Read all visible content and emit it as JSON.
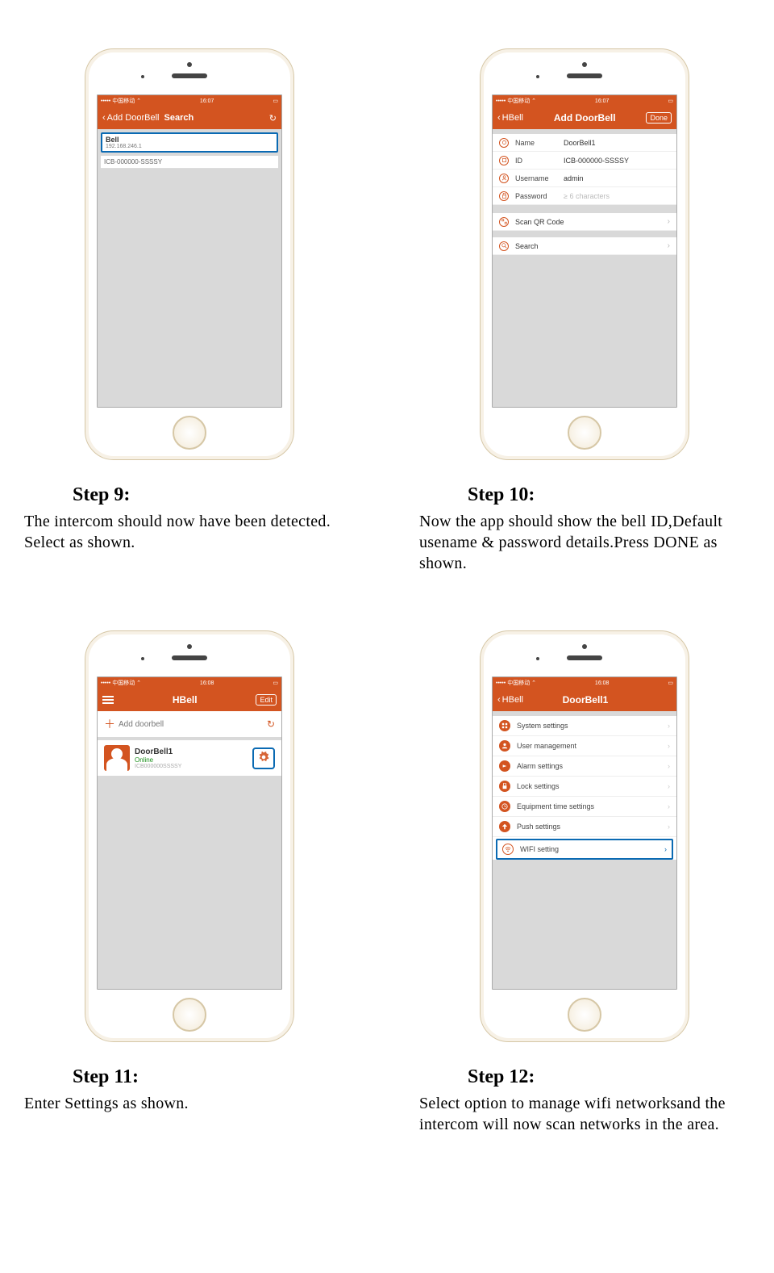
{
  "statusbar": {
    "carrier": "••••• 中国移动 ⌃",
    "time9": "16:07",
    "time10": "16:07",
    "time11": "16:08",
    "time12": "16:08"
  },
  "step9": {
    "title": "Step 9",
    "desc": "The intercom should now have been  detected. Select as shown.",
    "nav_back": "Add DoorBell",
    "nav_title": "Search",
    "bell_name": "Bell",
    "bell_ip": "192.168.246.1",
    "bell_id": "ICB-000000-SSSSY"
  },
  "step10": {
    "title": "Step 10",
    "desc": "Now the app should show the bell  ID,Default usename & password details.Press DONE as shown.",
    "nav_back": "HBell",
    "nav_title": "Add DoorBell",
    "nav_done": "Done",
    "fields": {
      "name_label": "Name",
      "name_value": "DoorBell1",
      "id_label": "ID",
      "id_value": "ICB-000000-SSSSY",
      "user_label": "Username",
      "user_value": "admin",
      "pass_label": "Password",
      "pass_placeholder": "≥ 6 characters"
    },
    "actions": {
      "scan": "Scan QR Code",
      "search": "Search"
    }
  },
  "step11": {
    "title": "Step 11",
    "desc": "Enter Settings as shown.",
    "nav_title": "HBell",
    "nav_edit": "Edit",
    "add_label": "Add doorbell",
    "device": {
      "name": "DoorBell1",
      "status": "Online",
      "id": "ICB000000SSSSY"
    }
  },
  "step12": {
    "title": "Step 12",
    "desc": "Select option to manage wifi networksand the intercom will now scan networks in the area.",
    "nav_back": "HBell",
    "nav_title": "DoorBell1",
    "menu": [
      "System settings",
      "User management",
      "Alarm settings",
      "Lock settings",
      "Equipment time settings",
      "Push settings",
      "WIFI setting"
    ]
  }
}
